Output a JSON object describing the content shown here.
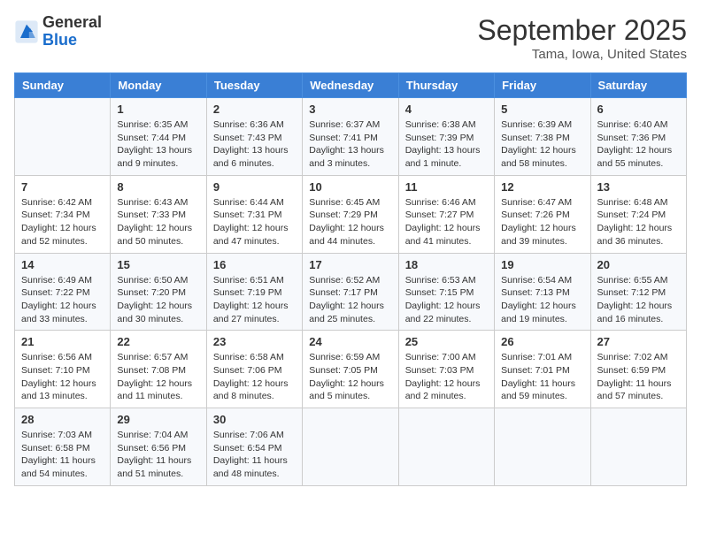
{
  "header": {
    "logo_general": "General",
    "logo_blue": "Blue",
    "month": "September 2025",
    "location": "Tama, Iowa, United States"
  },
  "weekdays": [
    "Sunday",
    "Monday",
    "Tuesday",
    "Wednesday",
    "Thursday",
    "Friday",
    "Saturday"
  ],
  "weeks": [
    [
      {
        "day": "",
        "info": ""
      },
      {
        "day": "1",
        "info": "Sunrise: 6:35 AM\nSunset: 7:44 PM\nDaylight: 13 hours\nand 9 minutes."
      },
      {
        "day": "2",
        "info": "Sunrise: 6:36 AM\nSunset: 7:43 PM\nDaylight: 13 hours\nand 6 minutes."
      },
      {
        "day": "3",
        "info": "Sunrise: 6:37 AM\nSunset: 7:41 PM\nDaylight: 13 hours\nand 3 minutes."
      },
      {
        "day": "4",
        "info": "Sunrise: 6:38 AM\nSunset: 7:39 PM\nDaylight: 13 hours\nand 1 minute."
      },
      {
        "day": "5",
        "info": "Sunrise: 6:39 AM\nSunset: 7:38 PM\nDaylight: 12 hours\nand 58 minutes."
      },
      {
        "day": "6",
        "info": "Sunrise: 6:40 AM\nSunset: 7:36 PM\nDaylight: 12 hours\nand 55 minutes."
      }
    ],
    [
      {
        "day": "7",
        "info": "Sunrise: 6:42 AM\nSunset: 7:34 PM\nDaylight: 12 hours\nand 52 minutes."
      },
      {
        "day": "8",
        "info": "Sunrise: 6:43 AM\nSunset: 7:33 PM\nDaylight: 12 hours\nand 50 minutes."
      },
      {
        "day": "9",
        "info": "Sunrise: 6:44 AM\nSunset: 7:31 PM\nDaylight: 12 hours\nand 47 minutes."
      },
      {
        "day": "10",
        "info": "Sunrise: 6:45 AM\nSunset: 7:29 PM\nDaylight: 12 hours\nand 44 minutes."
      },
      {
        "day": "11",
        "info": "Sunrise: 6:46 AM\nSunset: 7:27 PM\nDaylight: 12 hours\nand 41 minutes."
      },
      {
        "day": "12",
        "info": "Sunrise: 6:47 AM\nSunset: 7:26 PM\nDaylight: 12 hours\nand 39 minutes."
      },
      {
        "day": "13",
        "info": "Sunrise: 6:48 AM\nSunset: 7:24 PM\nDaylight: 12 hours\nand 36 minutes."
      }
    ],
    [
      {
        "day": "14",
        "info": "Sunrise: 6:49 AM\nSunset: 7:22 PM\nDaylight: 12 hours\nand 33 minutes."
      },
      {
        "day": "15",
        "info": "Sunrise: 6:50 AM\nSunset: 7:20 PM\nDaylight: 12 hours\nand 30 minutes."
      },
      {
        "day": "16",
        "info": "Sunrise: 6:51 AM\nSunset: 7:19 PM\nDaylight: 12 hours\nand 27 minutes."
      },
      {
        "day": "17",
        "info": "Sunrise: 6:52 AM\nSunset: 7:17 PM\nDaylight: 12 hours\nand 25 minutes."
      },
      {
        "day": "18",
        "info": "Sunrise: 6:53 AM\nSunset: 7:15 PM\nDaylight: 12 hours\nand 22 minutes."
      },
      {
        "day": "19",
        "info": "Sunrise: 6:54 AM\nSunset: 7:13 PM\nDaylight: 12 hours\nand 19 minutes."
      },
      {
        "day": "20",
        "info": "Sunrise: 6:55 AM\nSunset: 7:12 PM\nDaylight: 12 hours\nand 16 minutes."
      }
    ],
    [
      {
        "day": "21",
        "info": "Sunrise: 6:56 AM\nSunset: 7:10 PM\nDaylight: 12 hours\nand 13 minutes."
      },
      {
        "day": "22",
        "info": "Sunrise: 6:57 AM\nSunset: 7:08 PM\nDaylight: 12 hours\nand 11 minutes."
      },
      {
        "day": "23",
        "info": "Sunrise: 6:58 AM\nSunset: 7:06 PM\nDaylight: 12 hours\nand 8 minutes."
      },
      {
        "day": "24",
        "info": "Sunrise: 6:59 AM\nSunset: 7:05 PM\nDaylight: 12 hours\nand 5 minutes."
      },
      {
        "day": "25",
        "info": "Sunrise: 7:00 AM\nSunset: 7:03 PM\nDaylight: 12 hours\nand 2 minutes."
      },
      {
        "day": "26",
        "info": "Sunrise: 7:01 AM\nSunset: 7:01 PM\nDaylight: 11 hours\nand 59 minutes."
      },
      {
        "day": "27",
        "info": "Sunrise: 7:02 AM\nSunset: 6:59 PM\nDaylight: 11 hours\nand 57 minutes."
      }
    ],
    [
      {
        "day": "28",
        "info": "Sunrise: 7:03 AM\nSunset: 6:58 PM\nDaylight: 11 hours\nand 54 minutes."
      },
      {
        "day": "29",
        "info": "Sunrise: 7:04 AM\nSunset: 6:56 PM\nDaylight: 11 hours\nand 51 minutes."
      },
      {
        "day": "30",
        "info": "Sunrise: 7:06 AM\nSunset: 6:54 PM\nDaylight: 11 hours\nand 48 minutes."
      },
      {
        "day": "",
        "info": ""
      },
      {
        "day": "",
        "info": ""
      },
      {
        "day": "",
        "info": ""
      },
      {
        "day": "",
        "info": ""
      }
    ]
  ]
}
